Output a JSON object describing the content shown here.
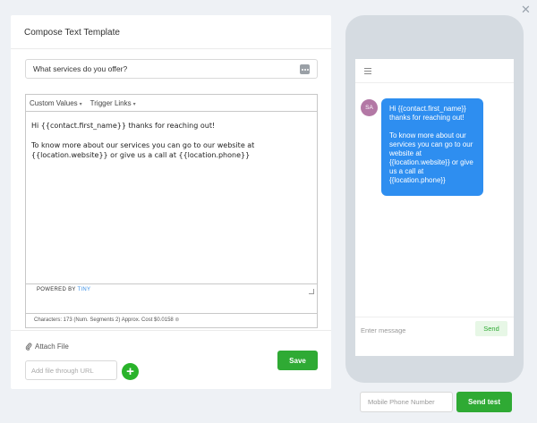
{
  "modal": {
    "close_icon": "close-icon",
    "close_glyph": "✕"
  },
  "editor_panel": {
    "title": "Compose Text Template",
    "template_name_value": "What services do you offer?",
    "options_icon": "ellipsis-icon",
    "toolbar": {
      "custom_values_label": "Custom Values",
      "trigger_links_label": "Trigger Links"
    },
    "body_lines": [
      "Hi {{contact.first_name}} thanks for reaching out!",
      "To know more about our services you can go to our website at {{location.website}} or give us a call at {{location.phone}}"
    ],
    "powered_by_label": "POWERED BY",
    "powered_by_brand": "TINY",
    "char_info": "Characters: 173 (Num. Segments 2) Approx. Cost $0.0158",
    "attach_label": "Attach File",
    "file_url_placeholder": "Add file through URL",
    "add_glyph": "+",
    "save_label": "Save"
  },
  "preview": {
    "avatar_initials": "SA",
    "message_paragraphs": [
      "Hi {{contact.first_name}} thanks for reaching out!",
      "To know more about our services you can go to our website at {{location.website}} or give us a call at {{location.phone}}"
    ],
    "message_placeholder": "Enter message",
    "send_label": "Send"
  },
  "test": {
    "phone_placeholder": "Mobile Phone Number",
    "send_test_label": "Send test"
  },
  "colors": {
    "primary_green": "#2faa34",
    "bubble_blue": "#2e8ef0",
    "avatar_purple": "#b378a5",
    "tiny_blue": "#3b8fe5"
  }
}
